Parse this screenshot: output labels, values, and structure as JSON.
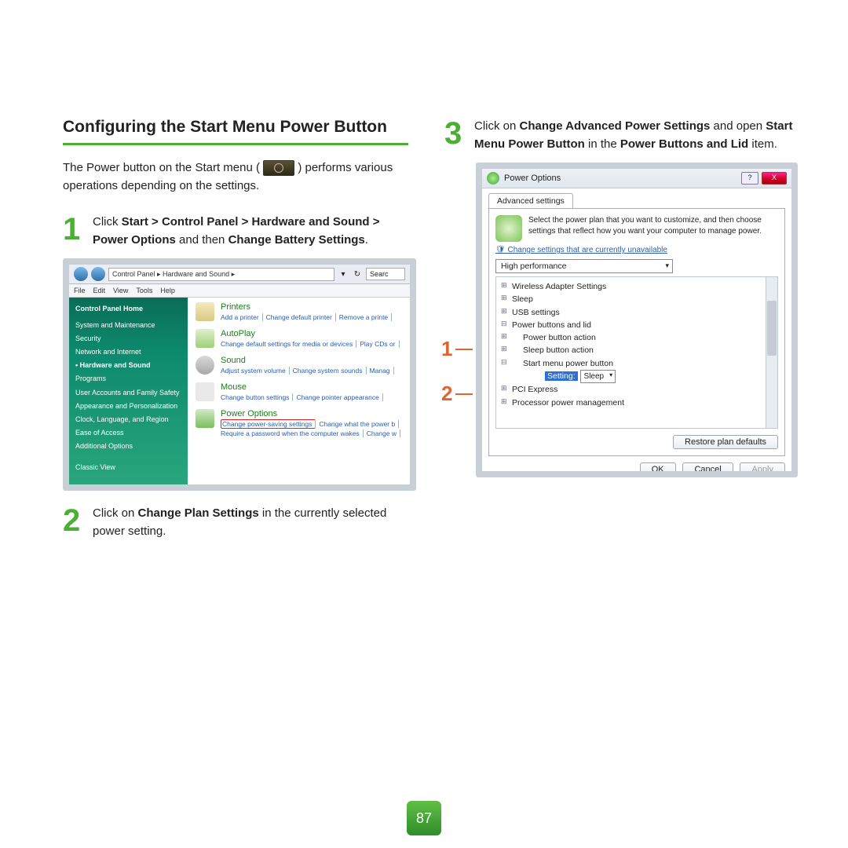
{
  "heading": "Configuring the Start Menu Power Button",
  "intro_a": "The Power button on the Start menu (",
  "intro_b": ") performs various operations depending on the settings.",
  "step1": {
    "num": "1",
    "t1": "Click ",
    "b1": "Start > Control Panel > Hardware and Sound > Power Options",
    "t2": " and then ",
    "b2": "Change Battery Settings",
    "t3": "."
  },
  "step2": {
    "num": "2",
    "t1": "Click on ",
    "b1": "Change Plan Settings",
    "t2": " in the currently selected power setting."
  },
  "step3": {
    "num": "3",
    "t1": "Click on ",
    "b1": "Change Advanced Power Settings",
    "t2": " and open ",
    "b2": "Start Menu Power Button",
    "t3": " in the ",
    "b3": "Power Buttons and Lid",
    "t4": " item."
  },
  "shot1": {
    "crumb": "Control Panel  ▸  Hardware and Sound  ▸",
    "search": "Searc",
    "menu": [
      "File",
      "Edit",
      "View",
      "Tools",
      "Help"
    ],
    "side_header": "Control Panel Home",
    "side": [
      "System and Maintenance",
      "Security",
      "Network and Internet",
      "Hardware and Sound",
      "Programs",
      "User Accounts and Family Safety",
      "Appearance and Personalization",
      "Clock, Language, and Region",
      "Ease of Access",
      "Additional Options",
      "",
      "Classic View"
    ],
    "side_selected": "Hardware and Sound",
    "cats": [
      {
        "title": "Printers",
        "subs": [
          "Add a printer",
          "Change default printer",
          "Remove a printe"
        ]
      },
      {
        "title": "AutoPlay",
        "subs": [
          "Change default settings for media or devices",
          "Play CDs or"
        ]
      },
      {
        "title": "Sound",
        "subs": [
          "Adjust system volume",
          "Change system sounds",
          "Manag"
        ]
      },
      {
        "title": "Mouse",
        "subs": [
          "Change button settings",
          "Change pointer appearance"
        ]
      },
      {
        "title": "Power Options",
        "subs": [
          "Change power-saving settings",
          "Change what the power b"
        ],
        "subs2": [
          "Require a password when the computer wakes",
          "Change w"
        ]
      }
    ]
  },
  "shot2": {
    "title": "Power Options",
    "tab": "Advanced settings",
    "desc": "Select the power plan that you want to customize, and then choose settings that reflect how you want your computer to manage power.",
    "link": "Change settings that are currently unavailable",
    "plan": "High performance",
    "tree": [
      "Wireless Adapter Settings",
      "Sleep",
      "USB settings"
    ],
    "pbl": "Power buttons and lid",
    "pba": "Power button action",
    "sba": "Sleep button action",
    "smpb": "Start menu power button",
    "setting_label": "Setting:",
    "setting_value": "Sleep",
    "tree_after": [
      "PCI Express",
      "Processor power management"
    ],
    "restore": "Restore plan defaults",
    "ok": "OK",
    "cancel": "Cancel",
    "apply": "Apply",
    "callout1": "1",
    "callout2": "2"
  },
  "page_number": "87"
}
